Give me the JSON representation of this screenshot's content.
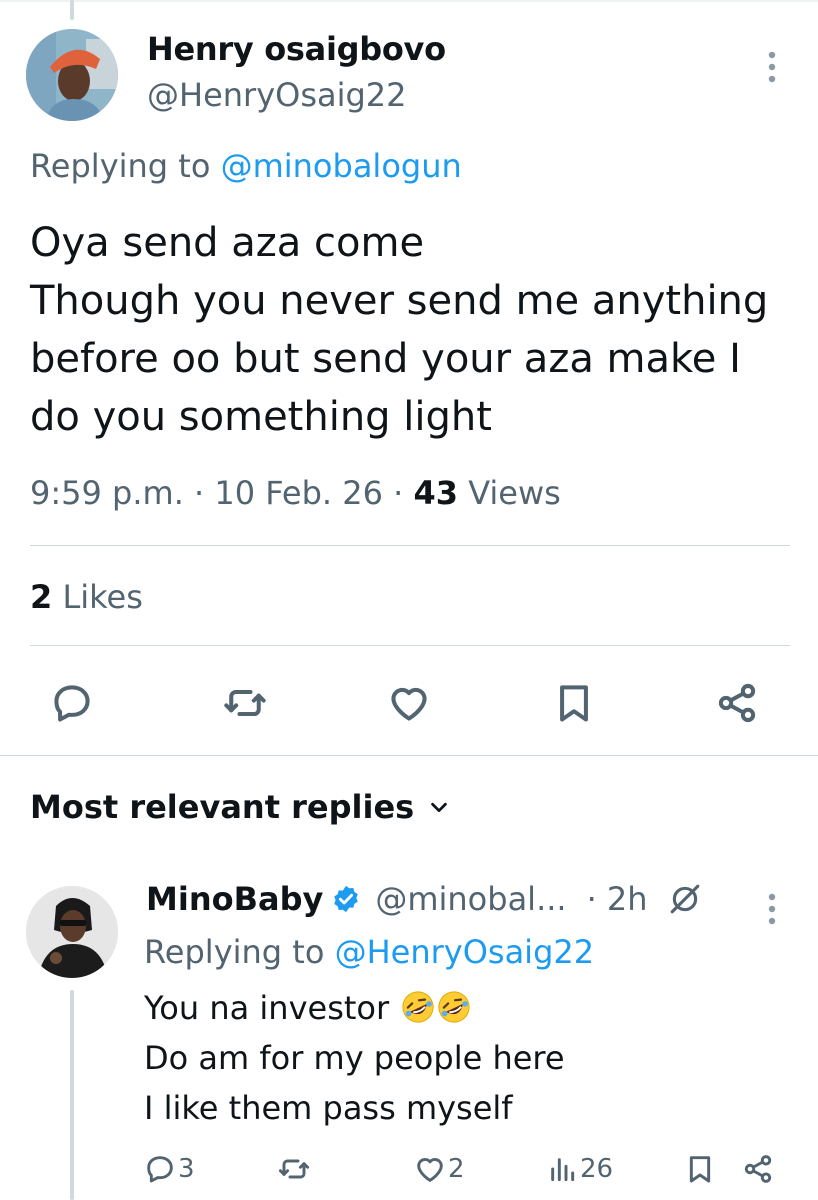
{
  "tweet": {
    "author_name": "Henry osaigbovo",
    "author_handle": "@HenryOsaig22",
    "replying_prefix": "Replying to ",
    "replying_to": "@minobalogun",
    "body_lines": [
      "Oya send aza come",
      "Though you never send me anything",
      "before oo but send your aza make I",
      "do you something light"
    ],
    "time": "9:59 p.m.",
    "separator": " · ",
    "date": "10 Feb. 26",
    "views_count": "43",
    "views_label": " Views",
    "likes_count": "2",
    "likes_label": " Likes",
    "icons": {
      "more": "more-vertical-icon",
      "reply": "reply-icon",
      "retweet": "retweet-icon",
      "like": "heart-icon",
      "bookmark": "bookmark-icon",
      "share": "share-icon"
    }
  },
  "replies_section": {
    "title": "Most relevant replies",
    "sort_icon": "chevron-down-icon"
  },
  "reply": {
    "author_name": "MinoBaby",
    "author_handle": "@minobal...",
    "time": "· 2h",
    "replying_prefix": "Replying to ",
    "replying_to": "@HenryOsaig22",
    "line1": "You na investor ",
    "line2": "Do am for my people here",
    "line3": "I like them pass myself",
    "reply_count": "3",
    "like_count": "2",
    "view_count": "26",
    "icons": {
      "verified": "verified-badge-icon",
      "grok": "grok-icon",
      "emoji": "rolling-on-floor-laughing-emoji",
      "views": "views-bar-chart-icon"
    }
  },
  "colors": {
    "text": "#0f1419",
    "secondary": "#536471",
    "link": "#1d9bf0",
    "divider": "#cfd9de"
  }
}
